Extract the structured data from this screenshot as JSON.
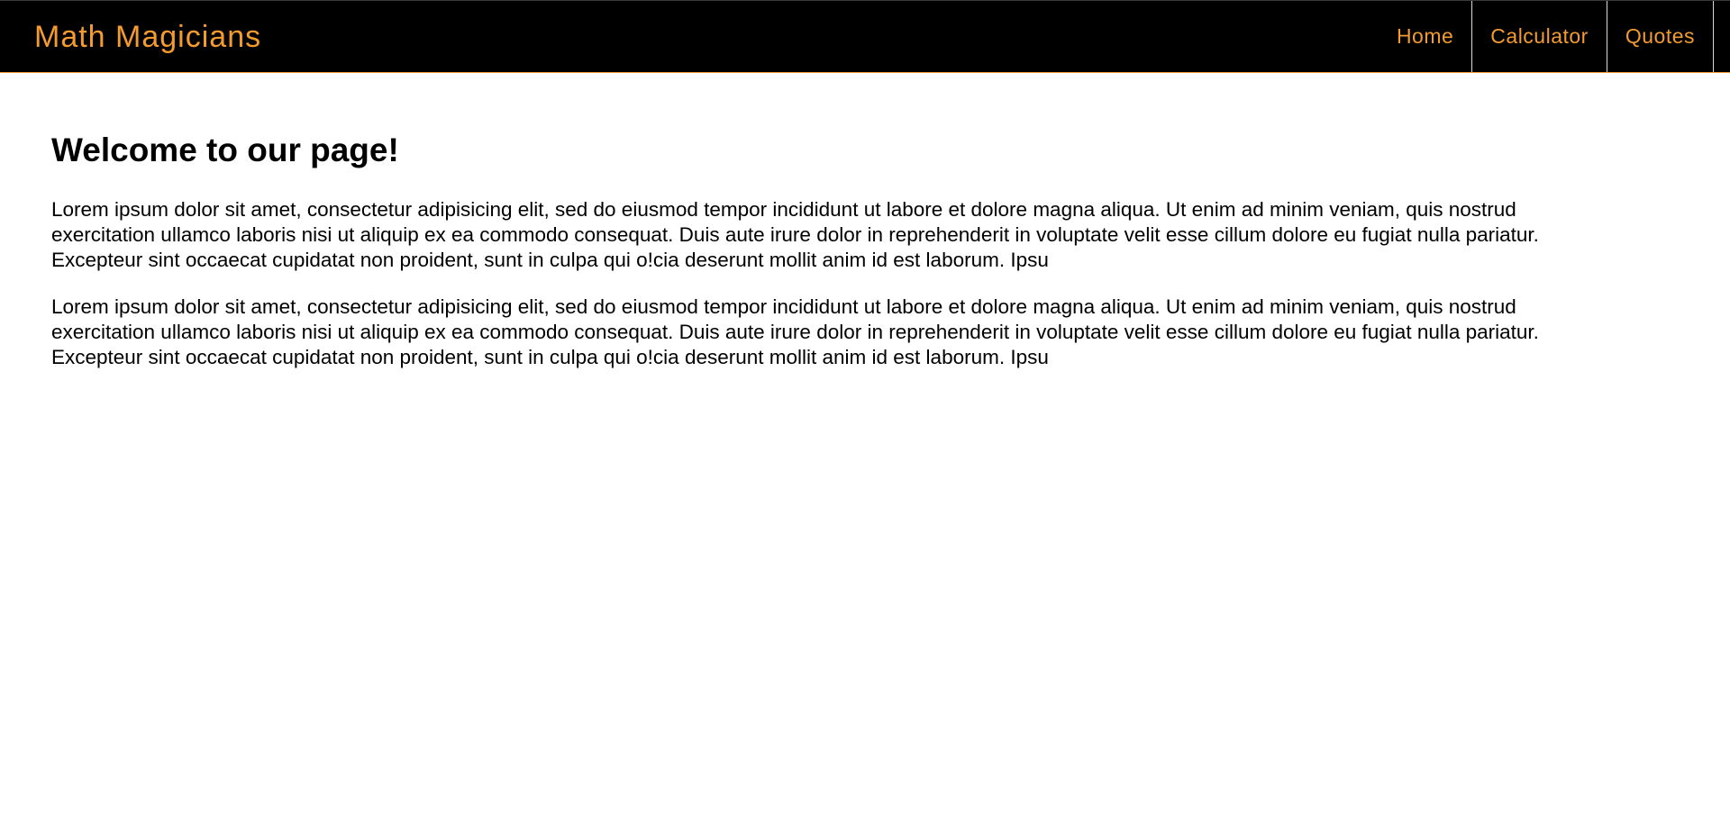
{
  "navbar": {
    "brand": "Math Magicians",
    "links": [
      {
        "label": "Home"
      },
      {
        "label": "Calculator"
      },
      {
        "label": "Quotes"
      }
    ]
  },
  "main": {
    "title": "Welcome to our page!",
    "paragraphs": [
      "Lorem ipsum dolor sit amet, consectetur adipisicing elit, sed do eiusmod tempor incididunt ut labore et dolore magna aliqua. Ut enim ad minim veniam, quis nostrud exercitation ullamco laboris nisi ut aliquip ex ea commodo consequat. Duis aute irure dolor in reprehenderit in voluptate velit esse cillum dolore eu fugiat nulla pariatur. Excepteur sint occaecat cupidatat non proident, sunt in culpa qui o!cia deserunt mollit anim id est laborum. Ipsu",
      "Lorem ipsum dolor sit amet, consectetur adipisicing elit, sed do eiusmod tempor incididunt ut labore et dolore magna aliqua. Ut enim ad minim veniam, quis nostrud exercitation ullamco laboris nisi ut aliquip ex ea commodo consequat. Duis aute irure dolor in reprehenderit in voluptate velit esse cillum dolore eu fugiat nulla pariatur. Excepteur sint occaecat cupidatat non proident, sunt in culpa qui o!cia deserunt mollit anim id est laborum. Ipsu"
    ]
  },
  "colors": {
    "accent": "#f39b2f",
    "navbar_bg": "#000000",
    "page_bg": "#ffffff",
    "text": "#000000"
  }
}
